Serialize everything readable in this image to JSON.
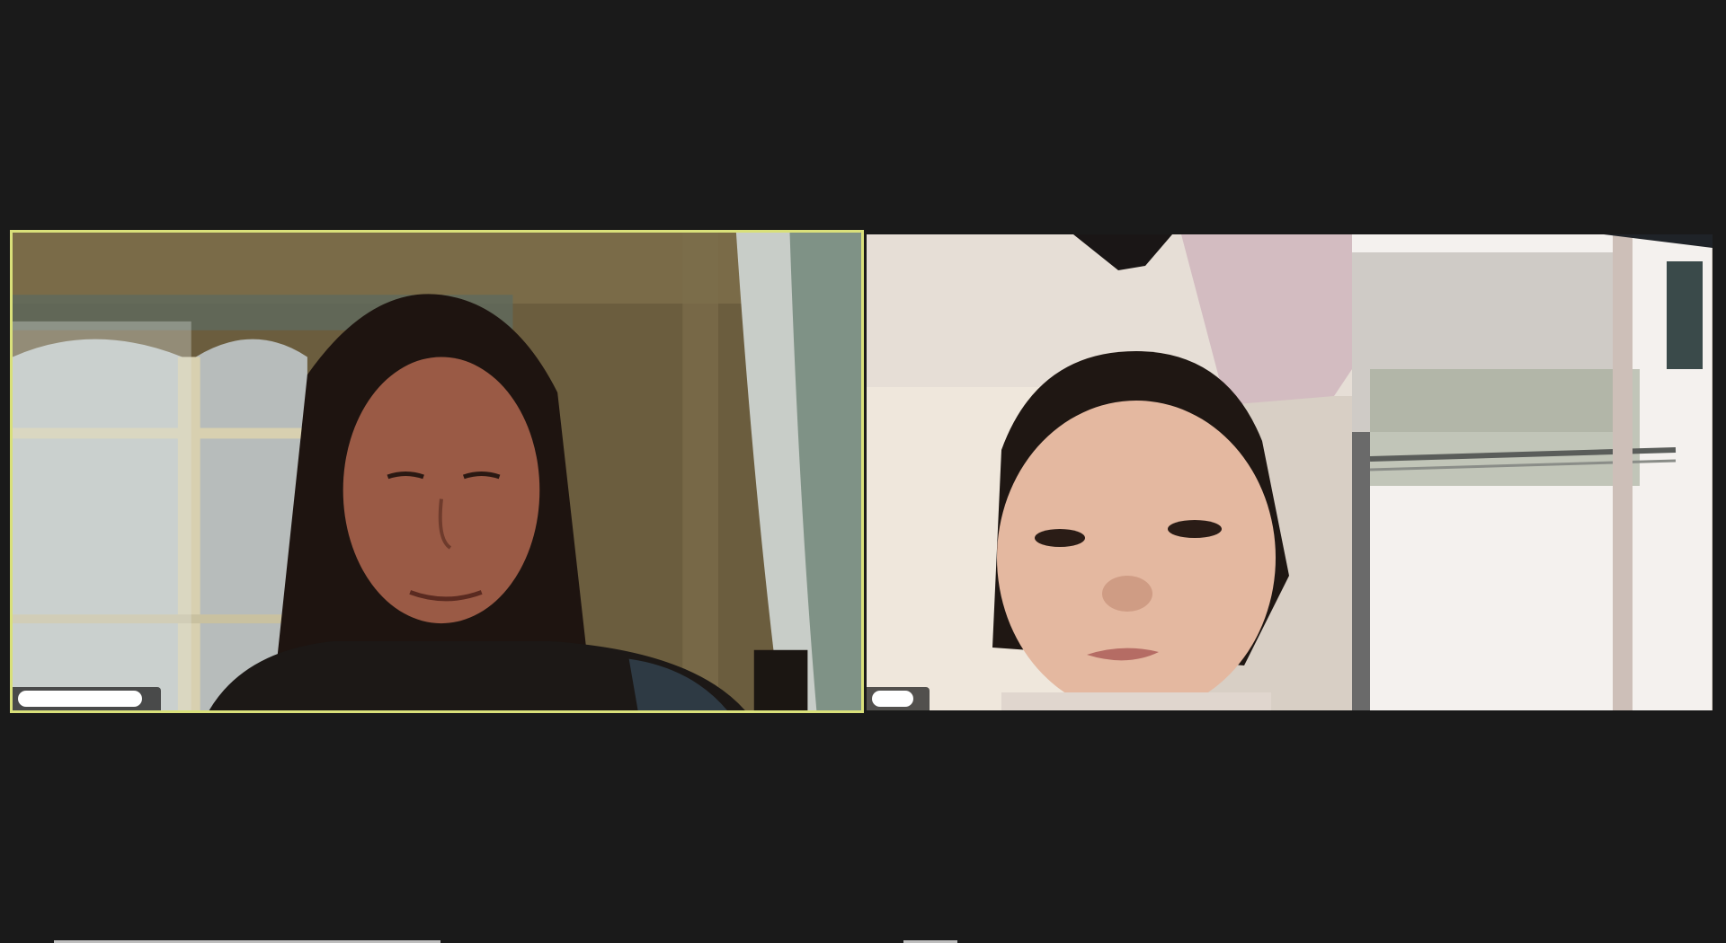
{
  "meeting": {
    "view": "gallery",
    "tiles": [
      {
        "id": "left",
        "active_speaker": true,
        "participant_name": "",
        "border_color": "#d9e07a"
      },
      {
        "id": "right",
        "active_speaker": false,
        "participant_name": ""
      }
    ]
  },
  "colors": {
    "background": "#1a1a1a",
    "active_border": "#d9e07a",
    "name_tag_bg": "#1e1e1e"
  }
}
